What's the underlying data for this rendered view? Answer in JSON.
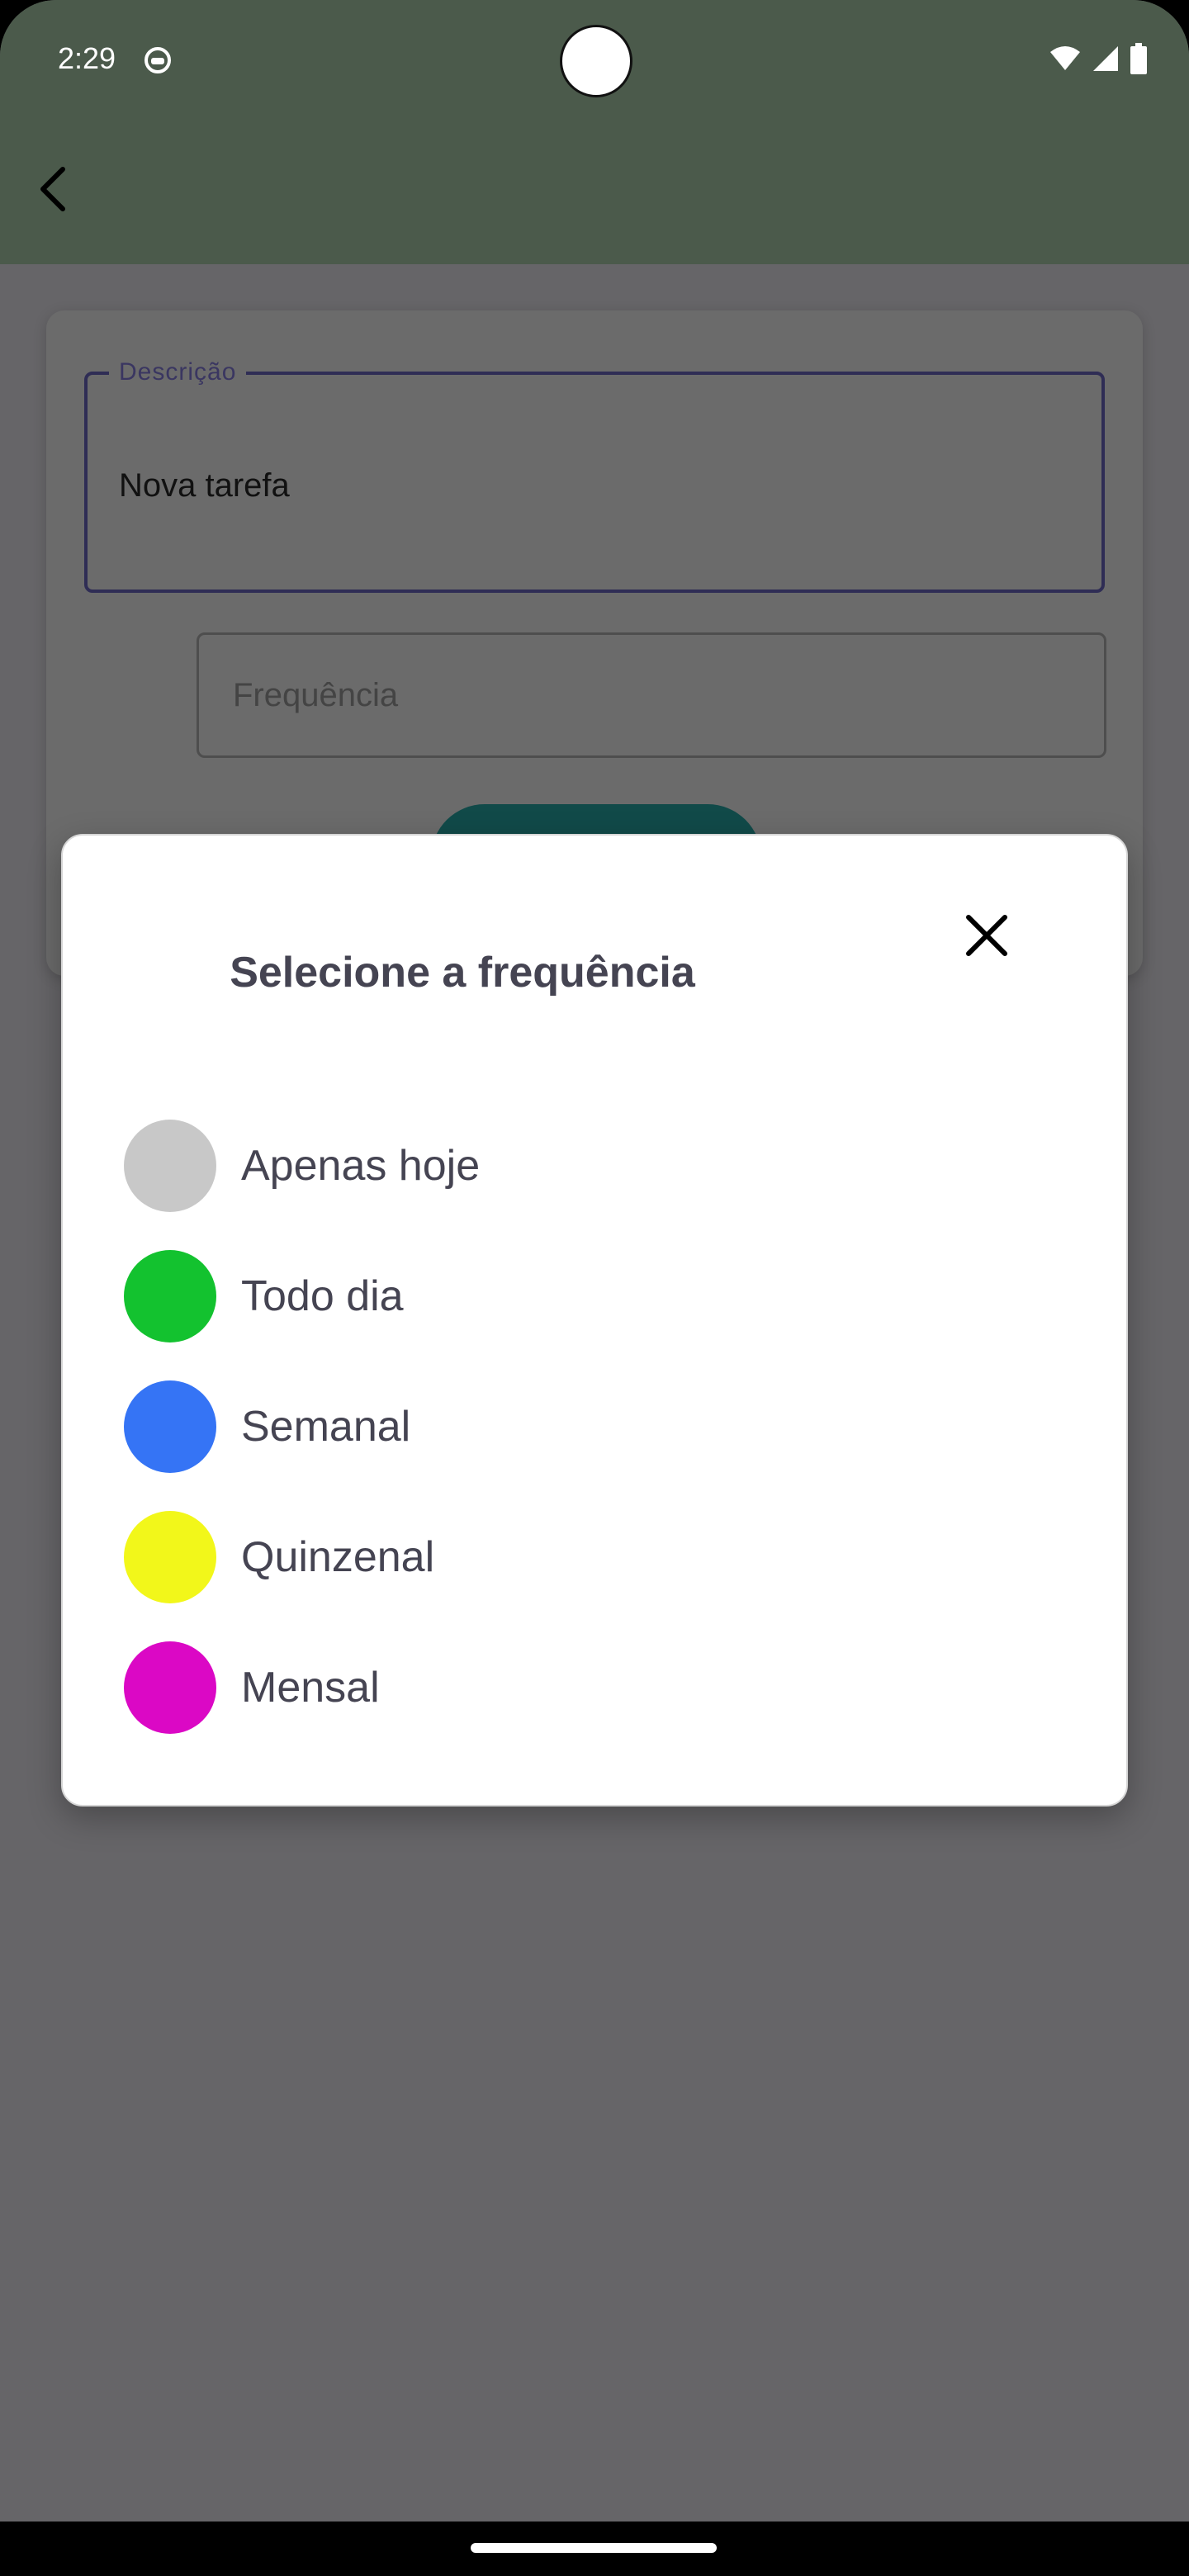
{
  "status_bar": {
    "time": "2:29"
  },
  "form": {
    "description_label": "Descrição",
    "description_value": "Nova tarefa",
    "frequency_placeholder": "Frequência"
  },
  "dialog": {
    "title": "Selecione a frequência",
    "options": [
      {
        "label": "Apenas hoje",
        "color": "#c8c8c8"
      },
      {
        "label": "Todo dia",
        "color": "#13c22f"
      },
      {
        "label": "Semanal",
        "color": "#3574f5"
      },
      {
        "label": "Quinzenal",
        "color": "#f2f71a"
      },
      {
        "label": "Mensal",
        "color": "#db08c5"
      }
    ]
  },
  "colors": {
    "app_bar": "#4b5a4b",
    "scrim": "#666568",
    "primary_button": "#114a49"
  },
  "icons": [
    "app-notification-icon",
    "wifi-icon",
    "signal-icon",
    "battery-icon",
    "back-arrow-icon",
    "close-icon"
  ]
}
